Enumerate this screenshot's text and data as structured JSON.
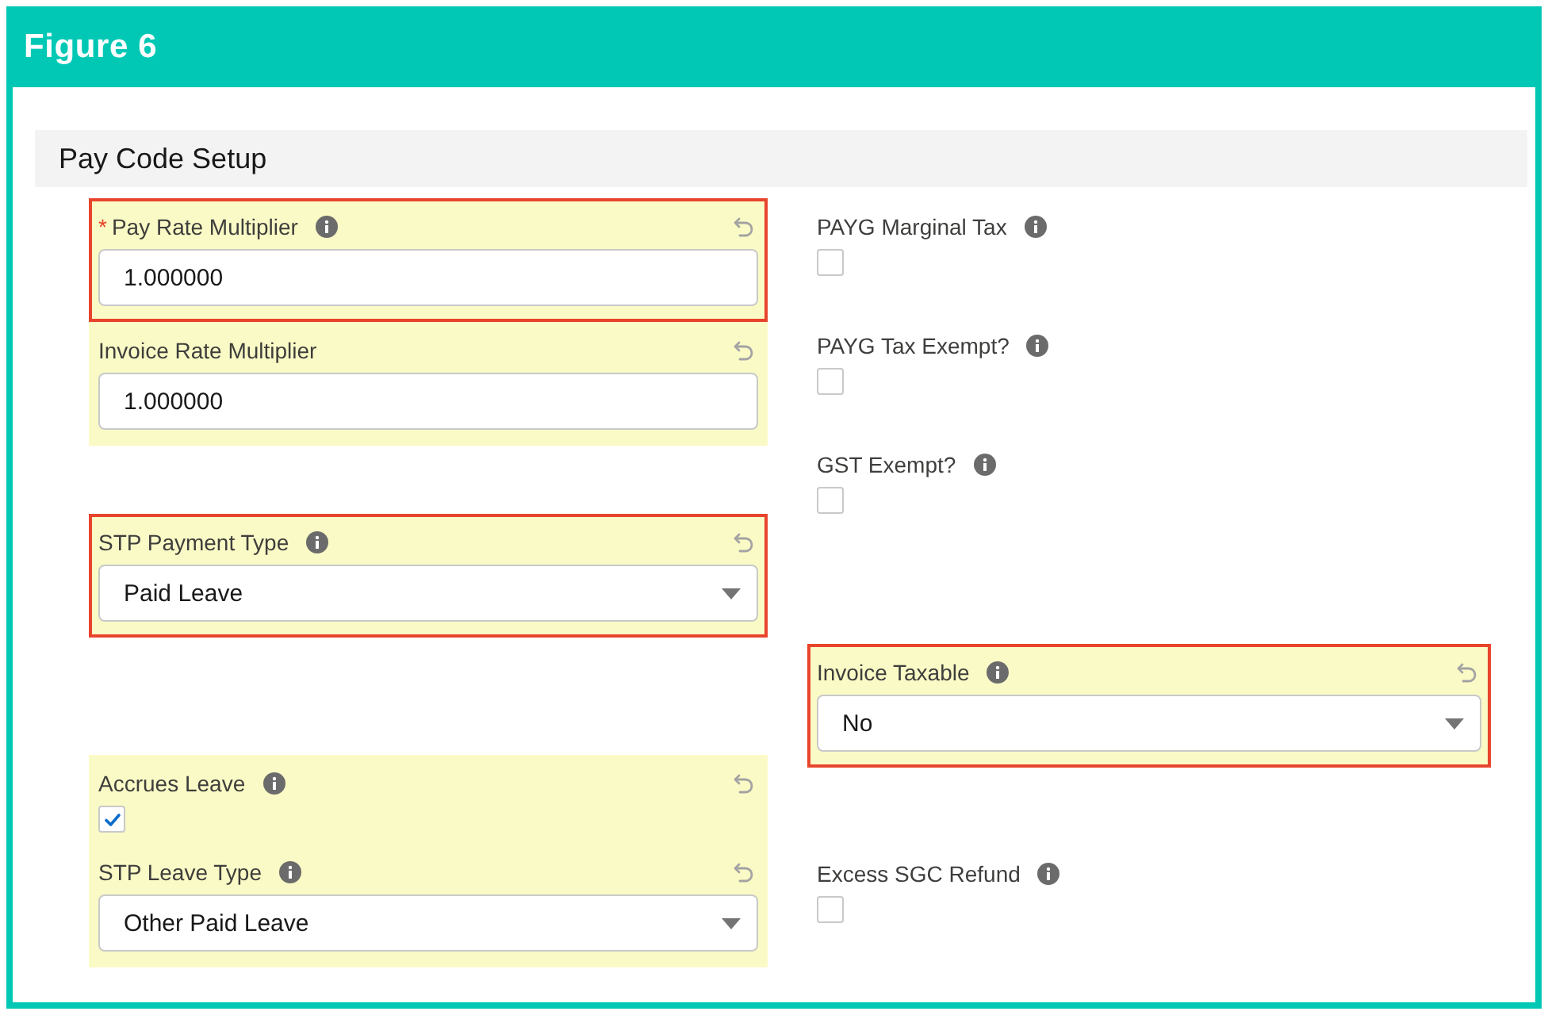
{
  "figure": {
    "title": "Figure 6"
  },
  "section": {
    "title": "Pay Code Setup"
  },
  "columns": [
    {
      "blocks": [
        {
          "changed": true,
          "outlined": true,
          "fields": [
            {
              "kind": "text",
              "label": "Pay Rate Multiplier",
              "required_mark": "*",
              "info": true,
              "value": "1.000000"
            }
          ]
        },
        {
          "changed": true,
          "outlined": false,
          "fields": [
            {
              "kind": "text",
              "label": "Invoice Rate Multiplier",
              "info": false,
              "value": "1.000000"
            }
          ]
        },
        {
          "changed": true,
          "outlined": true,
          "fields": [
            {
              "kind": "select",
              "label": "STP Payment Type",
              "info": true,
              "value": "Paid Leave"
            }
          ]
        },
        {
          "changed": true,
          "outlined": false,
          "fields": [
            {
              "kind": "checkbox",
              "label": "Accrues Leave",
              "info": true,
              "checked": true
            },
            {
              "kind": "select",
              "label": "STP Leave Type",
              "info": true,
              "value": "Other Paid Leave"
            }
          ]
        }
      ]
    },
    {
      "blocks": [
        {
          "changed": false,
          "outlined": false,
          "fields": [
            {
              "kind": "checkbox",
              "label": "PAYG Marginal Tax",
              "info": true,
              "checked": false
            }
          ]
        },
        {
          "changed": false,
          "outlined": false,
          "fields": [
            {
              "kind": "checkbox",
              "label": "PAYG Tax Exempt?",
              "info": true,
              "checked": false
            }
          ]
        },
        {
          "changed": false,
          "outlined": false,
          "fields": [
            {
              "kind": "checkbox",
              "label": "GST Exempt?",
              "info": true,
              "checked": false
            }
          ]
        },
        {
          "changed": true,
          "outlined": true,
          "fields": [
            {
              "kind": "select",
              "label": "Invoice Taxable",
              "info": true,
              "value": "No"
            }
          ]
        },
        {
          "changed": false,
          "outlined": false,
          "fields": [
            {
              "kind": "checkbox",
              "label": "Excess SGC Refund",
              "info": true,
              "checked": false
            }
          ]
        }
      ]
    }
  ]
}
